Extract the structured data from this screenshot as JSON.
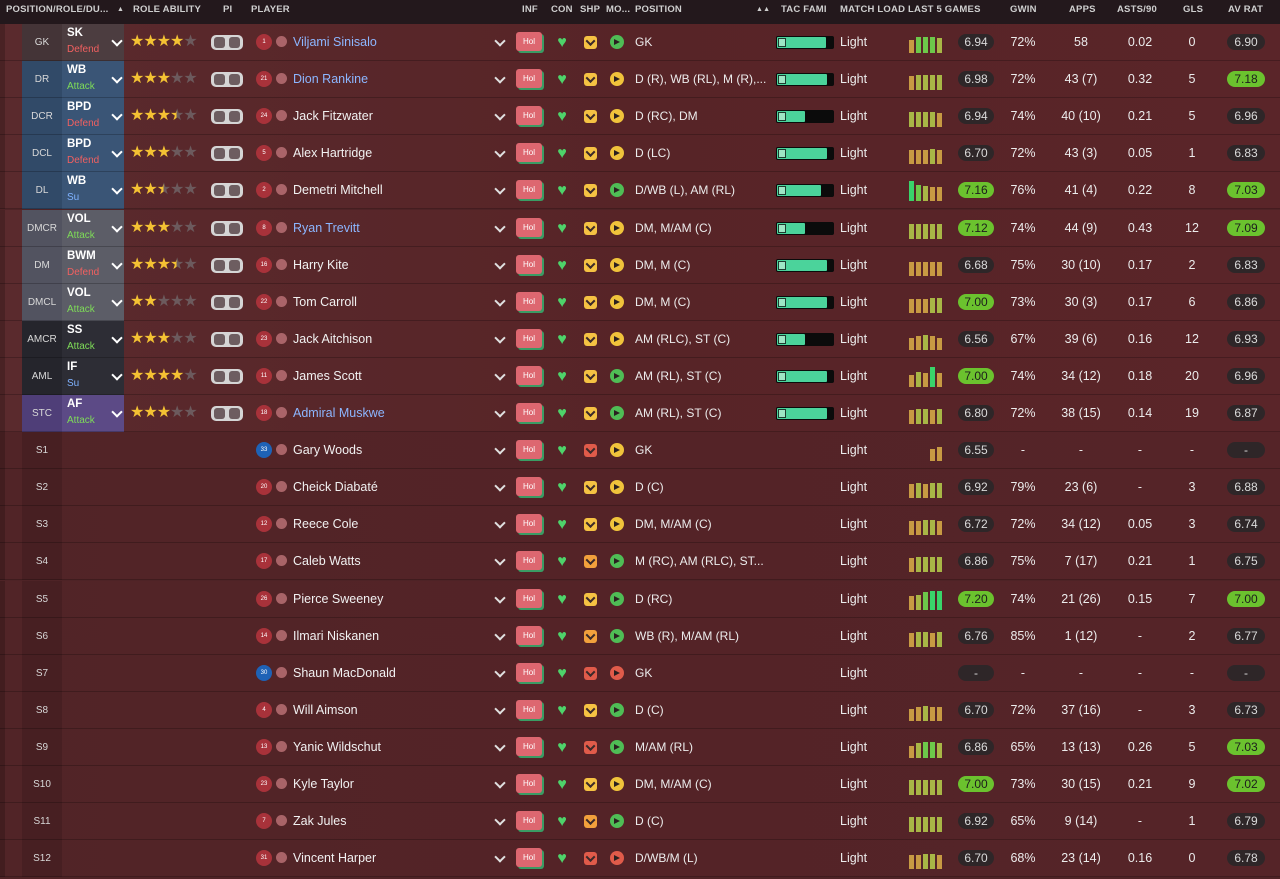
{
  "header": {
    "position_role_duty": "POSITION/ROLE/DU...",
    "role_ability": "ROLE ABILITY",
    "pi": "PI",
    "player": "PLAYER",
    "inf": "INF",
    "con": "CON",
    "shp": "SHP",
    "mo": "MO...",
    "position": "POSITION",
    "tac_fami": "TAC FAMI",
    "match_load": "MATCH LOAD",
    "last5": "LAST 5 GAMES",
    "gwin": "GWIN",
    "apps": "APPS",
    "asts90": "ASTS/90",
    "gls": "GLS",
    "av_rat": "AV RAT"
  },
  "colors": {
    "row_bg": "#572427",
    "accent_green": "#6bc22e",
    "star": "#f4c233",
    "link_blue": "#8cb6ff",
    "inf_badge": "#dd6770"
  },
  "rows": [
    {
      "pos": "GK",
      "role": "SK",
      "duty": "Defend",
      "stars": 4,
      "num": "1",
      "name": "Viljami Sinisalo",
      "link": true,
      "inf": "Hol",
      "shp": "y",
      "mo": "g",
      "position": "GK",
      "tac": 0.88,
      "load": "Light",
      "form": [
        0.65,
        0.8,
        0.8,
        0.8,
        0.75
      ],
      "last5": "6.94",
      "last5_hi": false,
      "gwin": "72%",
      "apps": "58",
      "asts": "0.02",
      "gls": "0",
      "av": "6.90",
      "av_hi": false
    },
    {
      "pos": "DR",
      "role": "WB",
      "duty": "Attack",
      "stars": 3,
      "num": "21",
      "name": "Dion Rankine",
      "link": true,
      "inf": "Hol",
      "shp": "y",
      "mo": "y",
      "position": "D (R), WB (RL), M (R),...",
      "tac": 0.9,
      "load": "Light",
      "form": [
        0.7,
        0.75,
        0.75,
        0.75,
        0.75
      ],
      "last5": "6.98",
      "last5_hi": false,
      "gwin": "72%",
      "apps": "43 (7)",
      "asts": "0.32",
      "gls": "5",
      "av": "7.18",
      "av_hi": true
    },
    {
      "pos": "DCR",
      "role": "BPD",
      "duty": "Defend",
      "stars": 3.5,
      "num": "24",
      "name": "Jack Fitzwater",
      "link": false,
      "inf": "Hol",
      "shp": "y",
      "mo": "y",
      "position": "D (RC), DM",
      "tac": 0.5,
      "load": "Light",
      "form": [
        0.75,
        0.75,
        0.75,
        0.75,
        0.7
      ],
      "last5": "6.94",
      "last5_hi": false,
      "gwin": "74%",
      "apps": "40 (10)",
      "asts": "0.21",
      "gls": "5",
      "av": "6.96",
      "av_hi": false
    },
    {
      "pos": "DCL",
      "role": "BPD",
      "duty": "Defend",
      "stars": 3,
      "num": "5",
      "name": "Alex Hartridge",
      "link": false,
      "inf": "Hol",
      "shp": "y",
      "mo": "y",
      "position": "D (LC)",
      "tac": 0.9,
      "load": "Light",
      "form": [
        0.7,
        0.7,
        0.7,
        0.75,
        0.7
      ],
      "last5": "6.70",
      "last5_hi": false,
      "gwin": "72%",
      "apps": "43 (3)",
      "asts": "0.05",
      "gls": "1",
      "av": "6.83",
      "av_hi": false
    },
    {
      "pos": "DL",
      "role": "WB",
      "duty": "Su",
      "stars": 2.5,
      "num": "2",
      "name": "Demetri Mitchell",
      "link": false,
      "inf": "Hol",
      "shp": "y",
      "mo": "g",
      "position": "D/WB (L), AM (RL)",
      "tac": 0.78,
      "load": "Light",
      "form": [
        1.0,
        0.8,
        0.75,
        0.7,
        0.7
      ],
      "last5": "7.16",
      "last5_hi": true,
      "gwin": "76%",
      "apps": "41 (4)",
      "asts": "0.22",
      "gls": "8",
      "av": "7.03",
      "av_hi": true
    },
    {
      "pos": "DMCR",
      "role": "VOL",
      "duty": "Attack",
      "stars": 3,
      "num": "8",
      "name": "Ryan Trevitt",
      "link": true,
      "inf": "Hol",
      "shp": "y",
      "mo": "y",
      "position": "DM, M/AM (C)",
      "tac": 0.5,
      "load": "Light",
      "form": [
        0.75,
        0.75,
        0.75,
        0.75,
        0.75
      ],
      "last5": "7.12",
      "last5_hi": true,
      "gwin": "74%",
      "apps": "44 (9)",
      "asts": "0.43",
      "gls": "12",
      "av": "7.09",
      "av_hi": true
    },
    {
      "pos": "DM",
      "role": "BWM",
      "duty": "Defend",
      "stars": 3.5,
      "num": "16",
      "name": "Harry Kite",
      "link": false,
      "inf": "Hol",
      "shp": "y",
      "mo": "y",
      "position": "DM, M (C)",
      "tac": 0.9,
      "load": "Light",
      "form": [
        0.7,
        0.7,
        0.7,
        0.7,
        0.7
      ],
      "last5": "6.68",
      "last5_hi": false,
      "gwin": "75%",
      "apps": "30 (10)",
      "asts": "0.17",
      "gls": "2",
      "av": "6.83",
      "av_hi": false
    },
    {
      "pos": "DMCL",
      "role": "VOL",
      "duty": "Attack",
      "stars": 2,
      "num": "22",
      "name": "Tom Carroll",
      "link": false,
      "inf": "Hol",
      "shp": "y",
      "mo": "y",
      "position": "DM, M (C)",
      "tac": 0.9,
      "load": "Light",
      "form": [
        0.7,
        0.7,
        0.7,
        0.75,
        0.75
      ],
      "last5": "7.00",
      "last5_hi": true,
      "gwin": "73%",
      "apps": "30 (3)",
      "asts": "0.17",
      "gls": "6",
      "av": "6.86",
      "av_hi": false
    },
    {
      "pos": "AMCR",
      "role": "SS",
      "duty": "Attack",
      "stars": 3,
      "num": "23",
      "name": "Jack Aitchison",
      "link": false,
      "inf": "Hol",
      "shp": "y",
      "mo": "y",
      "position": "AM (RLC), ST (C)",
      "tac": 0.5,
      "load": "Light",
      "form": [
        0.6,
        0.7,
        0.75,
        0.7,
        0.6
      ],
      "last5": "6.56",
      "last5_hi": false,
      "gwin": "67%",
      "apps": "39 (6)",
      "asts": "0.16",
      "gls": "12",
      "av": "6.93",
      "av_hi": false
    },
    {
      "pos": "AML",
      "role": "IF",
      "duty": "Su",
      "stars": 4,
      "num": "11",
      "name": "James Scott",
      "link": false,
      "inf": "Hol",
      "shp": "y",
      "mo": "g",
      "position": "AM (RL), ST (C)",
      "tac": 0.9,
      "load": "Light",
      "form": [
        0.6,
        0.75,
        0.7,
        1.0,
        0.7
      ],
      "last5": "7.00",
      "last5_hi": true,
      "gwin": "74%",
      "apps": "34 (12)",
      "asts": "0.18",
      "gls": "20",
      "av": "6.96",
      "av_hi": false
    },
    {
      "pos": "STC",
      "role": "AF",
      "duty": "Attack",
      "stars": 3,
      "num": "18",
      "name": "Admiral Muskwe",
      "link": true,
      "inf": "Hol",
      "shp": "y",
      "mo": "g",
      "position": "AM (RL), ST (C)",
      "tac": 0.9,
      "load": "Light",
      "form": [
        0.7,
        0.75,
        0.75,
        0.7,
        0.75
      ],
      "last5": "6.80",
      "last5_hi": false,
      "gwin": "72%",
      "apps": "38 (15)",
      "asts": "0.14",
      "gls": "19",
      "av": "6.87",
      "av_hi": false
    },
    {
      "pos": "S1",
      "num": "33",
      "gk": true,
      "name": "Gary Woods",
      "link": false,
      "inf": "Hol",
      "shp": "r",
      "mo": "y",
      "position": "GK",
      "load": "Light",
      "form": [
        0,
        0,
        0,
        0.6,
        0.7
      ],
      "last5": "6.55",
      "last5_hi": false,
      "gwin": "-",
      "apps": "-",
      "asts": "-",
      "gls": "-",
      "av": "-",
      "av_hi": false
    },
    {
      "pos": "S2",
      "num": "20",
      "name": "Cheick Diabaté",
      "link": false,
      "inf": "Hol",
      "shp": "y",
      "mo": "y",
      "position": "D (C)",
      "load": "Light",
      "form": [
        0.7,
        0.75,
        0.7,
        0.75,
        0.75
      ],
      "last5": "6.92",
      "last5_hi": false,
      "gwin": "79%",
      "apps": "23 (6)",
      "asts": "-",
      "gls": "3",
      "av": "6.88",
      "av_hi": false
    },
    {
      "pos": "S3",
      "num": "12",
      "name": "Reece Cole",
      "link": false,
      "inf": "Hol",
      "shp": "y",
      "mo": "y",
      "position": "DM, M/AM (C)",
      "load": "Light",
      "form": [
        0.7,
        0.7,
        0.75,
        0.75,
        0.7
      ],
      "last5": "6.72",
      "last5_hi": false,
      "gwin": "72%",
      "apps": "34 (12)",
      "asts": "0.05",
      "gls": "3",
      "av": "6.74",
      "av_hi": false
    },
    {
      "pos": "S4",
      "num": "17",
      "name": "Caleb Watts",
      "link": false,
      "inf": "Hol",
      "shp": "o",
      "mo": "g",
      "position": "M (RC), AM (RLC), ST...",
      "load": "Light",
      "form": [
        0.7,
        0.75,
        0.75,
        0.75,
        0.75
      ],
      "last5": "6.86",
      "last5_hi": false,
      "gwin": "75%",
      "apps": "7 (17)",
      "asts": "0.21",
      "gls": "1",
      "av": "6.75",
      "av_hi": false
    },
    {
      "pos": "S5",
      "num": "26",
      "name": "Pierce Sweeney",
      "link": false,
      "inf": "Hol",
      "shp": "y",
      "mo": "g",
      "position": "D (RC)",
      "load": "Light",
      "form": [
        0.7,
        0.75,
        0.9,
        0.95,
        0.95
      ],
      "last5": "7.20",
      "last5_hi": true,
      "gwin": "74%",
      "apps": "21 (26)",
      "asts": "0.15",
      "gls": "7",
      "av": "7.00",
      "av_hi": true
    },
    {
      "pos": "S6",
      "num": "14",
      "name": "Ilmari Niskanen",
      "link": false,
      "inf": "Hol",
      "shp": "o",
      "mo": "g",
      "position": "WB (R), M/AM (RL)",
      "load": "Light",
      "form": [
        0.7,
        0.75,
        0.75,
        0.7,
        0.75
      ],
      "last5": "6.76",
      "last5_hi": false,
      "gwin": "85%",
      "apps": "1 (12)",
      "asts": "-",
      "gls": "2",
      "av": "6.77",
      "av_hi": false
    },
    {
      "pos": "S7",
      "num": "30",
      "gk": true,
      "name": "Shaun MacDonald",
      "link": false,
      "inf": "Hol",
      "shp": "r",
      "mo": "r",
      "position": "GK",
      "load": "Light",
      "form": [],
      "last5": "-",
      "last5_hi": false,
      "gwin": "-",
      "apps": "-",
      "asts": "-",
      "gls": "-",
      "av": "-",
      "av_hi": false
    },
    {
      "pos": "S8",
      "num": "4",
      "name": "Will Aimson",
      "link": false,
      "inf": "Hol",
      "shp": "y",
      "mo": "g",
      "position": "D (C)",
      "load": "Light",
      "form": [
        0.6,
        0.7,
        0.75,
        0.7,
        0.7
      ],
      "last5": "6.70",
      "last5_hi": false,
      "gwin": "72%",
      "apps": "37 (16)",
      "asts": "-",
      "gls": "3",
      "av": "6.73",
      "av_hi": false
    },
    {
      "pos": "S9",
      "num": "13",
      "name": "Yanic Wildschut",
      "link": false,
      "inf": "Hol",
      "shp": "r",
      "mo": "g",
      "position": "M/AM (RL)",
      "load": "Light",
      "form": [
        0.6,
        0.75,
        0.8,
        0.8,
        0.75
      ],
      "last5": "6.86",
      "last5_hi": false,
      "gwin": "65%",
      "apps": "13 (13)",
      "asts": "0.26",
      "gls": "5",
      "av": "7.03",
      "av_hi": true
    },
    {
      "pos": "S10",
      "num": "23",
      "name": "Kyle Taylor",
      "link": false,
      "inf": "Hol",
      "shp": "y",
      "mo": "y",
      "position": "DM, M/AM (C)",
      "load": "Light",
      "form": [
        0.75,
        0.75,
        0.75,
        0.75,
        0.75
      ],
      "last5": "7.00",
      "last5_hi": true,
      "gwin": "73%",
      "apps": "30 (15)",
      "asts": "0.21",
      "gls": "9",
      "av": "7.02",
      "av_hi": true
    },
    {
      "pos": "S11",
      "num": "7",
      "name": "Zak Jules",
      "link": false,
      "inf": "Hol",
      "shp": "o",
      "mo": "g",
      "position": "D (C)",
      "load": "Light",
      "form": [
        0.75,
        0.75,
        0.75,
        0.75,
        0.75
      ],
      "last5": "6.92",
      "last5_hi": false,
      "gwin": "65%",
      "apps": "9 (14)",
      "asts": "-",
      "gls": "1",
      "av": "6.79",
      "av_hi": false
    },
    {
      "pos": "S12",
      "num": "31",
      "name": "Vincent Harper",
      "link": false,
      "inf": "Hol",
      "shp": "r",
      "mo": "r",
      "position": "D/WB/M (L)",
      "load": "Light",
      "form": [
        0.7,
        0.7,
        0.75,
        0.75,
        0.7
      ],
      "last5": "6.70",
      "last5_hi": false,
      "gwin": "68%",
      "apps": "23 (14)",
      "asts": "0.16",
      "gls": "0",
      "av": "6.78",
      "av_hi": false
    }
  ]
}
